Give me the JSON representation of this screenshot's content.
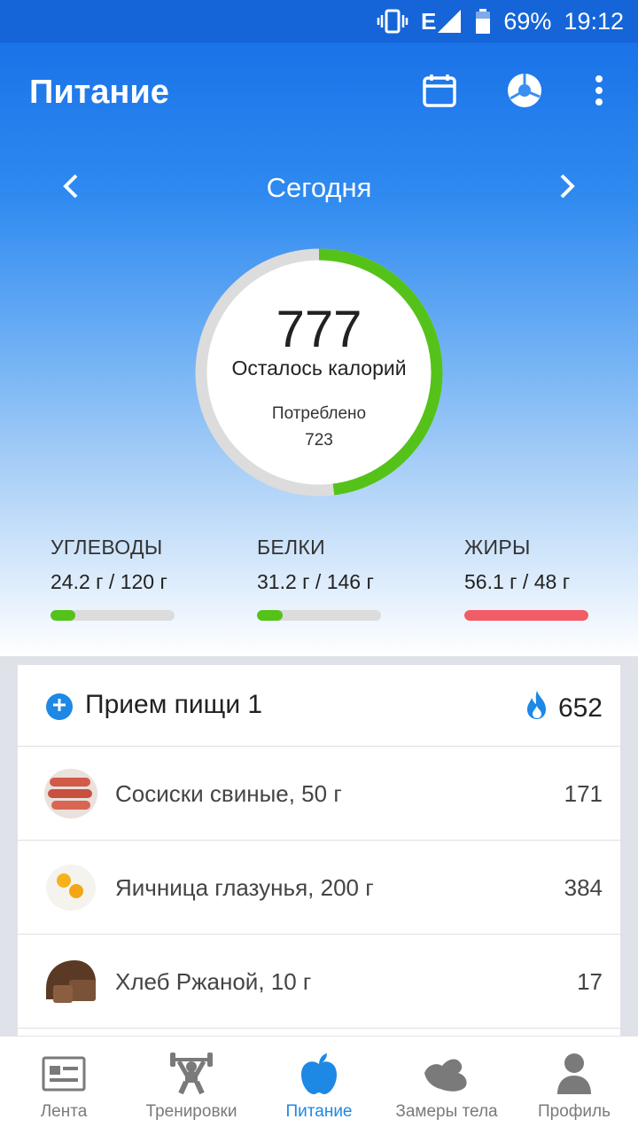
{
  "status_bar": {
    "network": "E",
    "battery": "69%",
    "time": "19:12"
  },
  "app_bar": {
    "title": "Питание",
    "icons": [
      "calendar-icon",
      "pie-chart-icon",
      "more-vert-icon"
    ]
  },
  "date_nav": {
    "label": "Сегодня",
    "prev_icon": "chevron-left-icon",
    "next_icon": "chevron-right-icon"
  },
  "calories": {
    "remaining": "777",
    "remaining_label": "Осталось калорий",
    "consumed_label": "Потреблено",
    "consumed": "723",
    "progress": 0.48,
    "ring_color": "#55c21a",
    "track_color": "#dcdcdc"
  },
  "macros": [
    {
      "name": "УГЛЕВОДЫ",
      "amount": "24.2 г / 120 г",
      "progress": 0.2,
      "color": "#55c21a"
    },
    {
      "name": "БЕЛКИ",
      "amount": "31.2 г / 146 г",
      "progress": 0.21,
      "color": "#55c21a"
    },
    {
      "name": "ЖИРЫ",
      "amount": "56.1 г / 48 г",
      "progress": 1.0,
      "color": "#f25c66"
    }
  ],
  "meal": {
    "title": "Прием пищи 1",
    "calories": "652",
    "add_icon": "plus-circle-icon",
    "fire_icon": "flame-icon",
    "items": [
      {
        "name": "Сосиски свиные, 50 г",
        "calories": "171",
        "image": "sausages-image"
      },
      {
        "name": "Яичница глазунья, 200 г",
        "calories": "384",
        "image": "fried-eggs-image"
      },
      {
        "name": "Хлеб Ржаной, 10 г",
        "calories": "17",
        "image": "rye-bread-image"
      }
    ]
  },
  "bottom_nav": {
    "items": [
      {
        "label": "Лента",
        "icon": "feed-icon",
        "active": false
      },
      {
        "label": "Тренировки",
        "icon": "workout-icon",
        "active": false
      },
      {
        "label": "Питание",
        "icon": "apple-icon",
        "active": true
      },
      {
        "label": "Замеры тела",
        "icon": "bicep-icon",
        "active": false
      },
      {
        "label": "Профиль",
        "icon": "profile-icon",
        "active": false
      }
    ],
    "active_color": "#1e88e5",
    "inactive_color": "#7a7a7a"
  }
}
